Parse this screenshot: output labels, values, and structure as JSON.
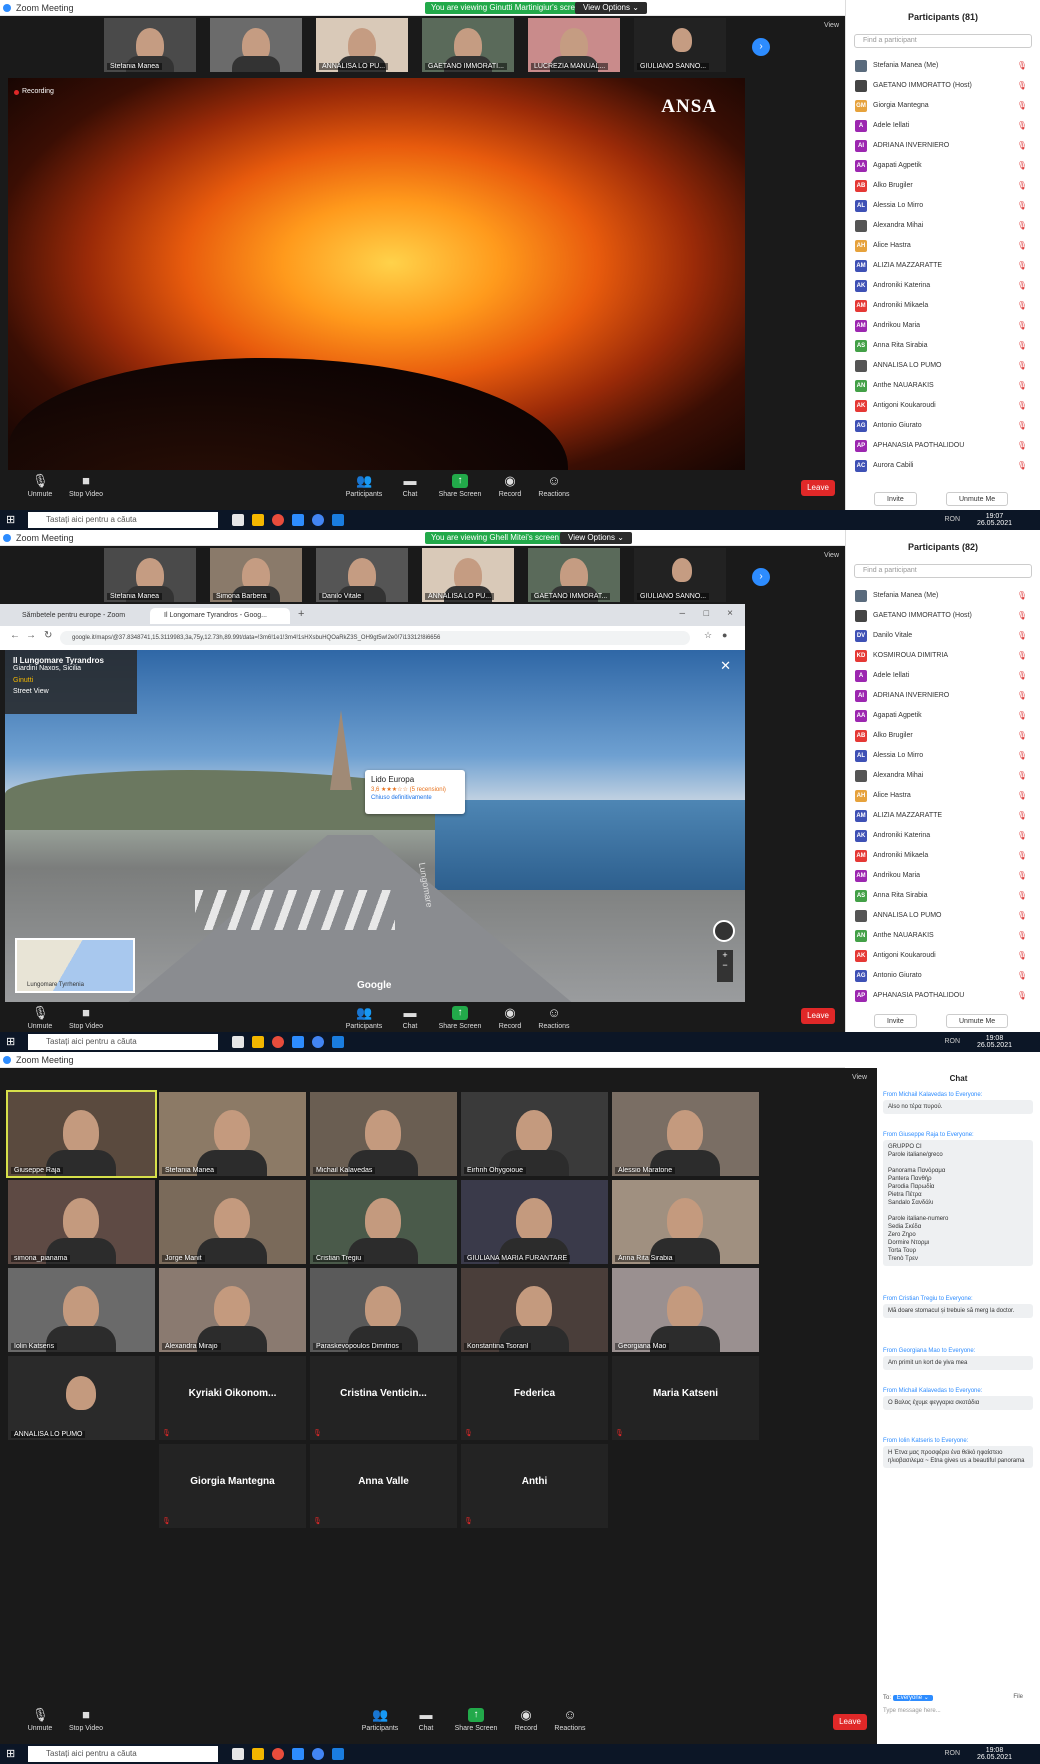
{
  "panel1": {
    "window_title": "Zoom Meeting",
    "banner": "You are viewing Ginutti Martinigiur's screen",
    "view_options": "View Options ⌄",
    "view_label": "View",
    "recording": "Recording",
    "watermark": "ANSA",
    "thumbnails": [
      "Stefania Manea",
      "",
      "ANNALISA LO PU...",
      "GAETANO IMMORATI...",
      "LUCREZIA MANUAL...",
      "GIULIANO SANNO..."
    ],
    "participants_header": "Participants (81)",
    "find_placeholder": "Find a participant",
    "participants": [
      {
        "initials": "",
        "name": "Stefania Manea (Me)",
        "color": "#5a6b7d"
      },
      {
        "initials": "",
        "name": "GAETANO IMMORATTO (Host)",
        "color": "#444"
      },
      {
        "initials": "GM",
        "name": "Giorgia Mantegna",
        "color": "#e6a23c"
      },
      {
        "initials": "A",
        "name": "Adele Iellati",
        "color": "#9c27b0"
      },
      {
        "initials": "AI",
        "name": "ADRIANA INVERNIERO",
        "color": "#9c27b0"
      },
      {
        "initials": "AA",
        "name": "Agapati Agpetik",
        "color": "#9c27b0"
      },
      {
        "initials": "AB",
        "name": "Alko Brugiler",
        "color": "#e53935"
      },
      {
        "initials": "AL",
        "name": "Alessia Lo Mirro",
        "color": "#3f51b5"
      },
      {
        "initials": "",
        "name": "Alexandra Mihai",
        "color": "#555"
      },
      {
        "initials": "AH",
        "name": "Alice Hastra",
        "color": "#e6a23c"
      },
      {
        "initials": "AM",
        "name": "ALIZIA MAZZARATTE",
        "color": "#3f51b5"
      },
      {
        "initials": "AK",
        "name": "Androniki Katerina",
        "color": "#3f51b5"
      },
      {
        "initials": "AM",
        "name": "Androniki Mikaela",
        "color": "#e53935"
      },
      {
        "initials": "AM",
        "name": "Andrikou Maria",
        "color": "#9c27b0"
      },
      {
        "initials": "AS",
        "name": "Anna Rita Sirabia",
        "color": "#43a047"
      },
      {
        "initials": "",
        "name": "ANNALISA LO PUMO",
        "color": "#555"
      },
      {
        "initials": "AN",
        "name": "Anthe NAUARAKIS",
        "color": "#43a047"
      },
      {
        "initials": "AK",
        "name": "Antigoni Koukaroudi",
        "color": "#e53935"
      },
      {
        "initials": "AG",
        "name": "Antonio Giurato",
        "color": "#3f51b5"
      },
      {
        "initials": "AP",
        "name": "APHANASIA PAOTHALIDOU",
        "color": "#9c27b0"
      },
      {
        "initials": "AC",
        "name": "Aurora Cabili",
        "color": "#3f51b5"
      }
    ],
    "invite": "Invite",
    "unmute_me": "Unmute Me"
  },
  "toolbar": {
    "unmute": "Unmute",
    "stop_video": "Stop Video",
    "participants": "Participants",
    "chat": "Chat",
    "share_screen": "Share Screen",
    "record": "Record",
    "reactions": "Reactions",
    "leave": "Leave",
    "participants_count": "81",
    "participants_count3": "21"
  },
  "taskbar": {
    "search": "Tastați aici pentru a căuta",
    "time1": "19:07",
    "time2": "19:08",
    "time3": "19:08",
    "date": "26.05.2021",
    "lang": "RON"
  },
  "panel2": {
    "window_title": "Zoom Meeting",
    "banner": "You are viewing Ghell Mitei's screen",
    "view_options": "View Options ⌄",
    "view_label": "View",
    "thumbnails": [
      "Stefania Manea",
      "Simona Barbera",
      "Danilo Vitale",
      "ANNALISA LO PU...",
      "GAETANO IMMORAT...",
      "GIULIANO SANNO..."
    ],
    "tabs": [
      "Sămbetele pentru europe - Zoom",
      "Il Longomare Tyrandros - Goog..."
    ],
    "url": "google.it/maps/@37.8348741,15.3119983,3a,75y,12.73h,89.99t/data=!3m6!1e1!3m4!1sHXsbuHQOaRkZ3S_OH9gt5w!2e0!7i13312!8i6656",
    "place_title": "Il Lungomare Tyrandros",
    "place_sub": "Giardini Naxos, Sicilia",
    "place_photo": "Ginutti",
    "place_more": "Street View",
    "lido_name": "Lido Europa",
    "lido_rating": "3,6 ★★★☆☆ (5 recensioni)",
    "lido_status": "Chiuso definitivamente",
    "google": "Google",
    "road_text": "Lungomare",
    "minimap_label": "Lungomare Tyrrhenia",
    "participants_header": "Participants (82)",
    "find_placeholder": "Find a participant",
    "participants": [
      {
        "initials": "",
        "name": "Stefania Manea (Me)",
        "color": "#5a6b7d"
      },
      {
        "initials": "",
        "name": "GAETANO IMMORATTO (Host)",
        "color": "#444"
      },
      {
        "initials": "DV",
        "name": "Danilo Vitale",
        "color": "#3f51b5"
      },
      {
        "initials": "KD",
        "name": "KOSMIROUA DIMITRIA",
        "color": "#e53935"
      },
      {
        "initials": "A",
        "name": "Adele Iellati",
        "color": "#9c27b0"
      },
      {
        "initials": "AI",
        "name": "ADRIANA INVERNIERO",
        "color": "#9c27b0"
      },
      {
        "initials": "AA",
        "name": "Agapati Agpetik",
        "color": "#9c27b0"
      },
      {
        "initials": "AB",
        "name": "Alko Brugiler",
        "color": "#e53935"
      },
      {
        "initials": "AL",
        "name": "Alessia Lo Mirro",
        "color": "#3f51b5"
      },
      {
        "initials": "",
        "name": "Alexandra Mihai",
        "color": "#555"
      },
      {
        "initials": "AH",
        "name": "Alice Hastra",
        "color": "#e6a23c"
      },
      {
        "initials": "AM",
        "name": "ALIZIA MAZZARATTE",
        "color": "#3f51b5"
      },
      {
        "initials": "AK",
        "name": "Androniki Katerina",
        "color": "#3f51b5"
      },
      {
        "initials": "AM",
        "name": "Androniki Mikaela",
        "color": "#e53935"
      },
      {
        "initials": "AM",
        "name": "Andrikou Maria",
        "color": "#9c27b0"
      },
      {
        "initials": "AS",
        "name": "Anna Rita Sirabia",
        "color": "#43a047"
      },
      {
        "initials": "",
        "name": "ANNALISA LO PUMO",
        "color": "#555"
      },
      {
        "initials": "AN",
        "name": "Anthe NAUARAKIS",
        "color": "#43a047"
      },
      {
        "initials": "AK",
        "name": "Antigoni Koukaroudi",
        "color": "#e53935"
      },
      {
        "initials": "AG",
        "name": "Antonio Giurato",
        "color": "#3f51b5"
      },
      {
        "initials": "AP",
        "name": "APHANASIA PAOTHALIDOU",
        "color": "#9c27b0"
      }
    ],
    "invite": "Invite",
    "unmute_me": "Unmute Me"
  },
  "panel3": {
    "window_title": "Zoom Meeting",
    "view_label": "View",
    "tiles": [
      {
        "name": "Giuseppe Raja",
        "video": true
      },
      {
        "name": "Stefania Manea",
        "video": true
      },
      {
        "name": "Michail Kalavedas",
        "video": true
      },
      {
        "name": "Eirhnh Ohygoioue",
        "video": true
      },
      {
        "name": "Alessio Maratone",
        "video": true
      },
      {
        "name": "simona_pianama",
        "video": true
      },
      {
        "name": "Jorge Manit",
        "video": true
      },
      {
        "name": "Cristian Tregiu",
        "video": true
      },
      {
        "name": "GIULIANA MARIA FURANTARE",
        "video": true
      },
      {
        "name": "Anna Rita Sirabia",
        "video": true
      },
      {
        "name": "Iolin Katseris",
        "video": true
      },
      {
        "name": "Alexandra Mirajo",
        "video": true
      },
      {
        "name": "Paraskevopoulos Dimitrios",
        "video": true
      },
      {
        "name": "Konstantina Tsoranl",
        "video": true
      },
      {
        "name": "Georgiana Mao",
        "video": true
      },
      {
        "name": "ANNALISA LO PUMO",
        "video": true
      },
      {
        "name": "Kyriaki Oikonom...",
        "video": false
      },
      {
        "name": "Cristina Venticin...",
        "video": false
      },
      {
        "name": "Federica",
        "video": false
      },
      {
        "name": "Maria Katseni",
        "video": false
      },
      {
        "name": "Giorgia Mantegna",
        "video": false
      },
      {
        "name": "Anna Valle",
        "video": false
      },
      {
        "name": "Anthi",
        "video": false
      }
    ],
    "chat_header": "Chat",
    "messages": [
      {
        "from": "From Michail Kalavedas to Everyone:",
        "text": "Also no τέρα πυρού."
      },
      {
        "from": "From Giuseppe Raja to Everyone:",
        "text": "GRUPPO CI\nParole italiane/greco\n\nPanorama      Πανόραμα\nPantera        Πανθήρ\nParodia        Παρωδία\nPietra          Πέτρα\nSandalo        Σανδάλι\n\nParole italiane-numero\nSedia           Σκέδα\nZero            Ζηρο\nDormire        Ντορμι\nTorta           Τουρ\nTrenò           Τρεν"
      },
      {
        "from": "From Cristian Tregiu to Everyone:",
        "text": "Mă doare stomacul și trebuie să merg la doctor."
      },
      {
        "from": "From Georgiana Mao to Everyone:",
        "text": "Am primit un kort de yiva mea"
      },
      {
        "from": "From Michail Kalavedas to Everyone:",
        "text": "Ο Βαλος έχυμε φεγγαρια σκοτάδια"
      },
      {
        "from": "From Iolin Katseris to Everyone:",
        "text": "Η Έτνα μας προσφέρει ένα θεϊκό ηφαίστειο ηλιοβασιλεμα ~ Etna gives us a beautiful panorama"
      }
    ],
    "to_label": "To:",
    "to_value": "Everyone ⌄",
    "file_label": "File",
    "type_placeholder": "Type message here..."
  }
}
